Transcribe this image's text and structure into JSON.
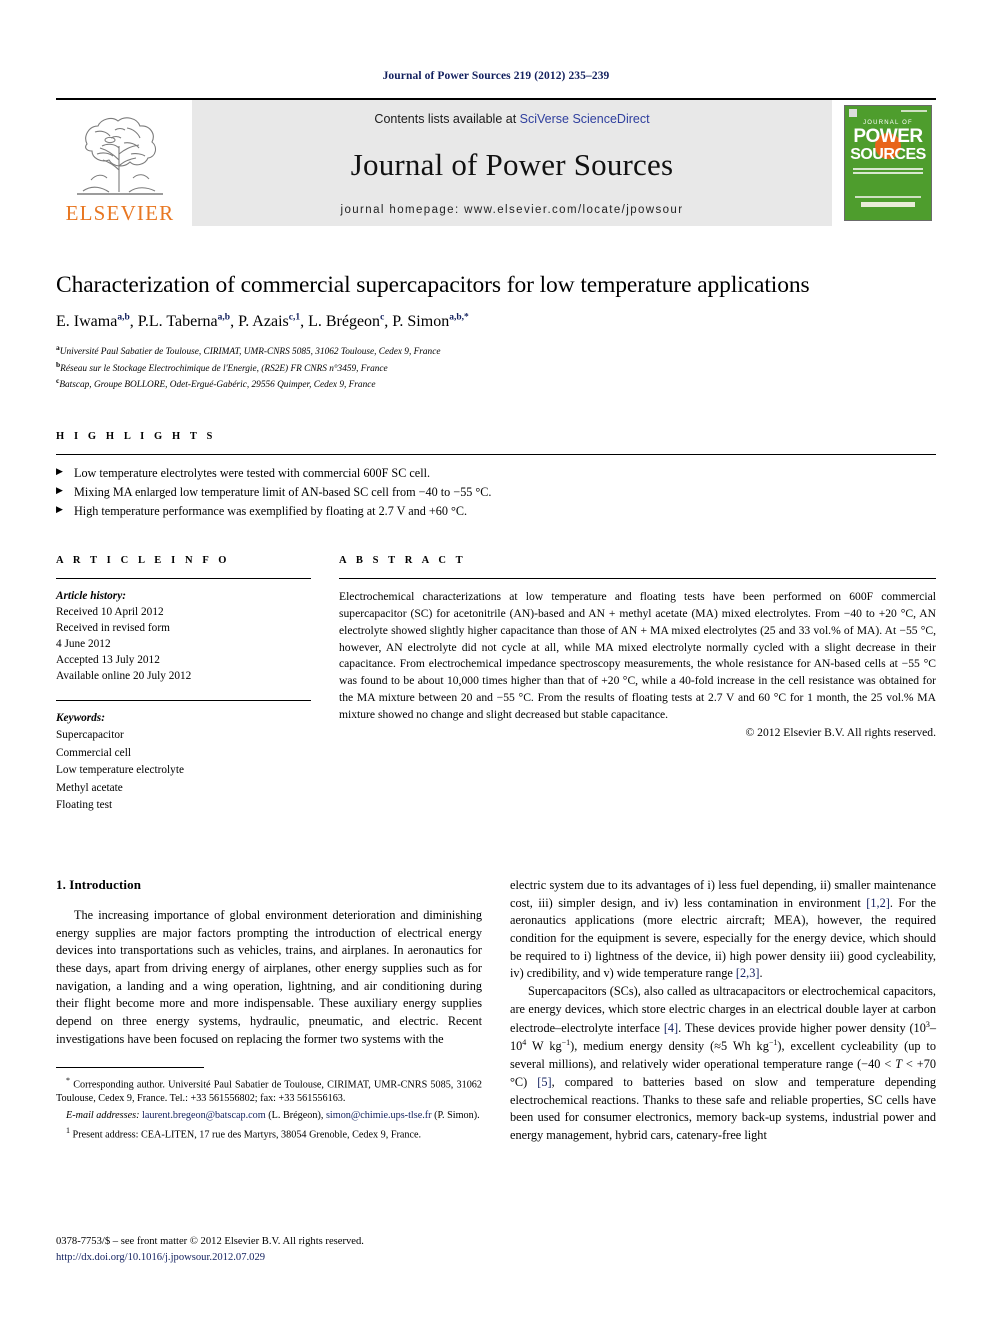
{
  "running_head": "Journal of Power Sources 219 (2012) 235–239",
  "masthead": {
    "contents_prefix": "Contents lists available at ",
    "contents_link": "SciVerse ScienceDirect",
    "journal_name": "Journal of Power Sources",
    "homepage": "journal homepage: www.elsevier.com/locate/jpowsour",
    "publisher_wordmark": "ELSEVIER",
    "publisher_color": "#e87722",
    "link_color": "#2f3f9e",
    "cover": {
      "line_journal_of": "JOURNAL OF",
      "line_power": "POWER",
      "line_sources": "SOURCES",
      "background_color": "#4e9d2d",
      "accent_color": "#e8641a"
    }
  },
  "article": {
    "title": "Characterization of commercial supercapacitors for low temperature applications",
    "authors": [
      {
        "name": "E. Iwama",
        "marks": "a,b",
        "sep": ", "
      },
      {
        "name": "P.L. Taberna",
        "marks": "a,b",
        "sep": ", "
      },
      {
        "name": "P. Azais",
        "marks": "c,1",
        "sep": ", "
      },
      {
        "name": "L. Brégeon",
        "marks": "c",
        "sep": ", "
      },
      {
        "name": "P. Simon",
        "marks": "a,b,*",
        "sep": ""
      }
    ],
    "affiliations": [
      {
        "mark": "a",
        "text": "Université Paul Sabatier de Toulouse, CIRIMAT, UMR-CNRS 5085, 31062 Toulouse, Cedex 9, France"
      },
      {
        "mark": "b",
        "text": "Réseau sur le Stockage Electrochimique de l'Energie, (RS2E) FR CNRS n°3459, France"
      },
      {
        "mark": "c",
        "text": "Batscap, Groupe BOLLORE, Odet-Ergué-Gabéric, 29556 Quimper, Cedex 9, France"
      }
    ]
  },
  "highlights": {
    "label": "H I G H L I G H T S",
    "items": [
      "Low temperature electrolytes were tested with commercial 600F SC cell.",
      "Mixing MA enlarged low temperature limit of AN-based SC cell from −40 to −55 °C.",
      "High temperature performance was exemplified by floating at 2.7 V and +60 °C."
    ]
  },
  "article_info": {
    "label": "A R T I C L E  I N F O",
    "history_label": "Article history:",
    "history": [
      "Received 10 April 2012",
      "Received in revised form",
      "4 June 2012",
      "Accepted 13 July 2012",
      "Available online 20 July 2012"
    ],
    "keywords_label": "Keywords:",
    "keywords": [
      "Supercapacitor",
      "Commercial cell",
      "Low temperature electrolyte",
      "Methyl acetate",
      "Floating test"
    ]
  },
  "abstract": {
    "label": "A B S T R A C T",
    "text": "Electrochemical characterizations at low temperature and floating tests have been performed on 600F commercial supercapacitor (SC) for acetonitrile (AN)-based and AN + methyl acetate (MA) mixed electrolytes. From −40 to +20 °C, AN electrolyte showed slightly higher capacitance than those of AN + MA mixed electrolytes (25 and 33 vol.% of MA). At −55 °C, however, AN electrolyte did not cycle at all, while MA mixed electrolyte normally cycled with a slight decrease in their capacitance. From electrochemical impedance spectroscopy measurements, the whole resistance for AN-based cells at −55 °C was found to be about 10,000 times higher than that of +20 °C, while a 40-fold increase in the cell resistance was obtained for the MA mixture between 20 and −55 °C. From the results of floating tests at 2.7 V and 60 °C for 1 month, the 25 vol.% MA mixture showed no change and slight decreased but stable capacitance.",
    "copyright": "© 2012 Elsevier B.V. All rights reserved."
  },
  "introduction": {
    "heading": "1. Introduction",
    "para1": "The increasing importance of global environment deterioration and diminishing energy supplies are major factors prompting the introduction of electrical energy devices into transportations such as vehicles, trains, and airplanes. In aeronautics for these days, apart from driving energy of airplanes, other energy supplies such as for navigation, a landing and a wing operation, lightning, and air conditioning during their flight become more and more indispensable. These auxiliary energy supplies depend on three energy systems, hydraulic, pneumatic, and electric. Recent investigations have been focused on replacing the former two systems with the",
    "para1_cont_a": "electric system due to its advantages of i) less fuel depending, ii) smaller maintenance cost, iii) simpler design, and iv) less contamination in environment ",
    "para1_cite1": "[1,2]",
    "para1_cont_b": ". For the aeronautics applications (more electric aircraft; MEA), however, the required condition for the equipment is severe, especially for the energy device, which should be required to i) lightness of the device, ii) high power density iii) good cycleability, iv) credibility, and v) wide temperature range ",
    "para1_cite2": "[2,3]",
    "para1_cont_c": ".",
    "para2_a": "Supercapacitors (SCs), also called as ultracapacitors or electrochemical capacitors, are energy devices, which store electric charges in an electrical double layer at carbon electrode–electrolyte interface ",
    "para2_cite1": "[4]",
    "para2_b": ". These devices provide higher power density (10",
    "para2_sup1": "3",
    "para2_c": "–10",
    "para2_sup2": "4",
    "para2_d": " W kg",
    "para2_sup3": "−1",
    "para2_e": "), medium energy density (≈5 Wh kg",
    "para2_sup4": "−1",
    "para2_f": "), excellent cycleability (up to several millions), and relatively wider operational temperature range (−40 < ",
    "para2_italT": "T",
    "para2_g": " < +70 °C) ",
    "para2_cite2": "[5]",
    "para2_h": ", compared to batteries based on slow and temperature depending electrochemical reactions. Thanks to these safe and reliable properties, SC cells have been used for consumer electronics, memory back-up systems, industrial power and energy management, hybrid cars, catenary-free light"
  },
  "footnotes": {
    "corresponding": "Corresponding author. Université Paul Sabatier de Toulouse, CIRIMAT, UMR-CNRS 5085, 31062 Toulouse, Cedex 9, France. Tel.: +33 561556802; fax: +33 561556163.",
    "email_label": "E-mail addresses:",
    "email1": "laurent.bregeon@batscap.com",
    "email1_attr": " (L. Brégeon), ",
    "email2": "simon@chimie.ups-tlse.fr",
    "email2_attr": " (P. Simon).",
    "present_address_mark": "1",
    "present_address": "Present address: CEA-LITEN, 17 rue des Martyrs, 38054 Grenoble, Cedex 9, France."
  },
  "page_footer": {
    "issn_line": "0378-7753/$ – see front matter © 2012 Elsevier B.V. All rights reserved.",
    "doi": "http://dx.doi.org/10.1016/j.jpowsour.2012.07.029"
  }
}
